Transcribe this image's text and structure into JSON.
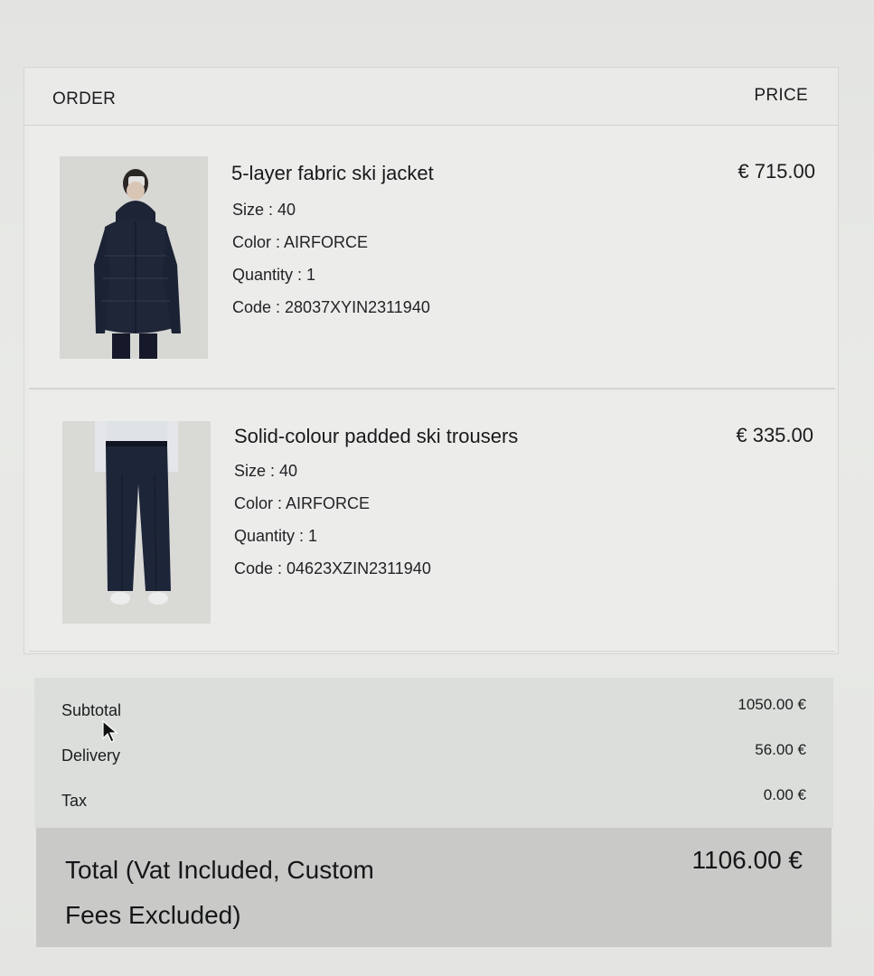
{
  "order": {
    "header_order": "ORDER",
    "header_price": "PRICE",
    "items": [
      {
        "name": "5-layer fabric ski jacket",
        "size": "Size : 40",
        "color": "Color : AIRFORCE",
        "quantity": "Quantity : 1",
        "code": "Code : 28037XYIN2311940",
        "price": "€ 715.00",
        "image_icon": "ski-jacket-photo"
      },
      {
        "name": "Solid-colour padded ski trousers",
        "size": "Size : 40",
        "color": "Color : AIRFORCE",
        "quantity": "Quantity : 1",
        "code": "Code : 04623XZIN2311940",
        "price": "€ 335.00",
        "image_icon": "ski-trousers-photo"
      }
    ]
  },
  "summary": {
    "subtotal_label": "Subtotal",
    "subtotal_value": "1050.00 €",
    "delivery_label": "Delivery",
    "delivery_value": "56.00 €",
    "tax_label": "Tax",
    "tax_value": "0.00 €"
  },
  "total": {
    "label": "Total (Vat Included, Custom Fees Excluded)",
    "value": "1106.00 €"
  },
  "colors": {
    "background": "#e6e7e4",
    "summary_bg": "#dcdedb",
    "total_bg": "#c9cac7",
    "product_navy": "#1d2435"
  }
}
